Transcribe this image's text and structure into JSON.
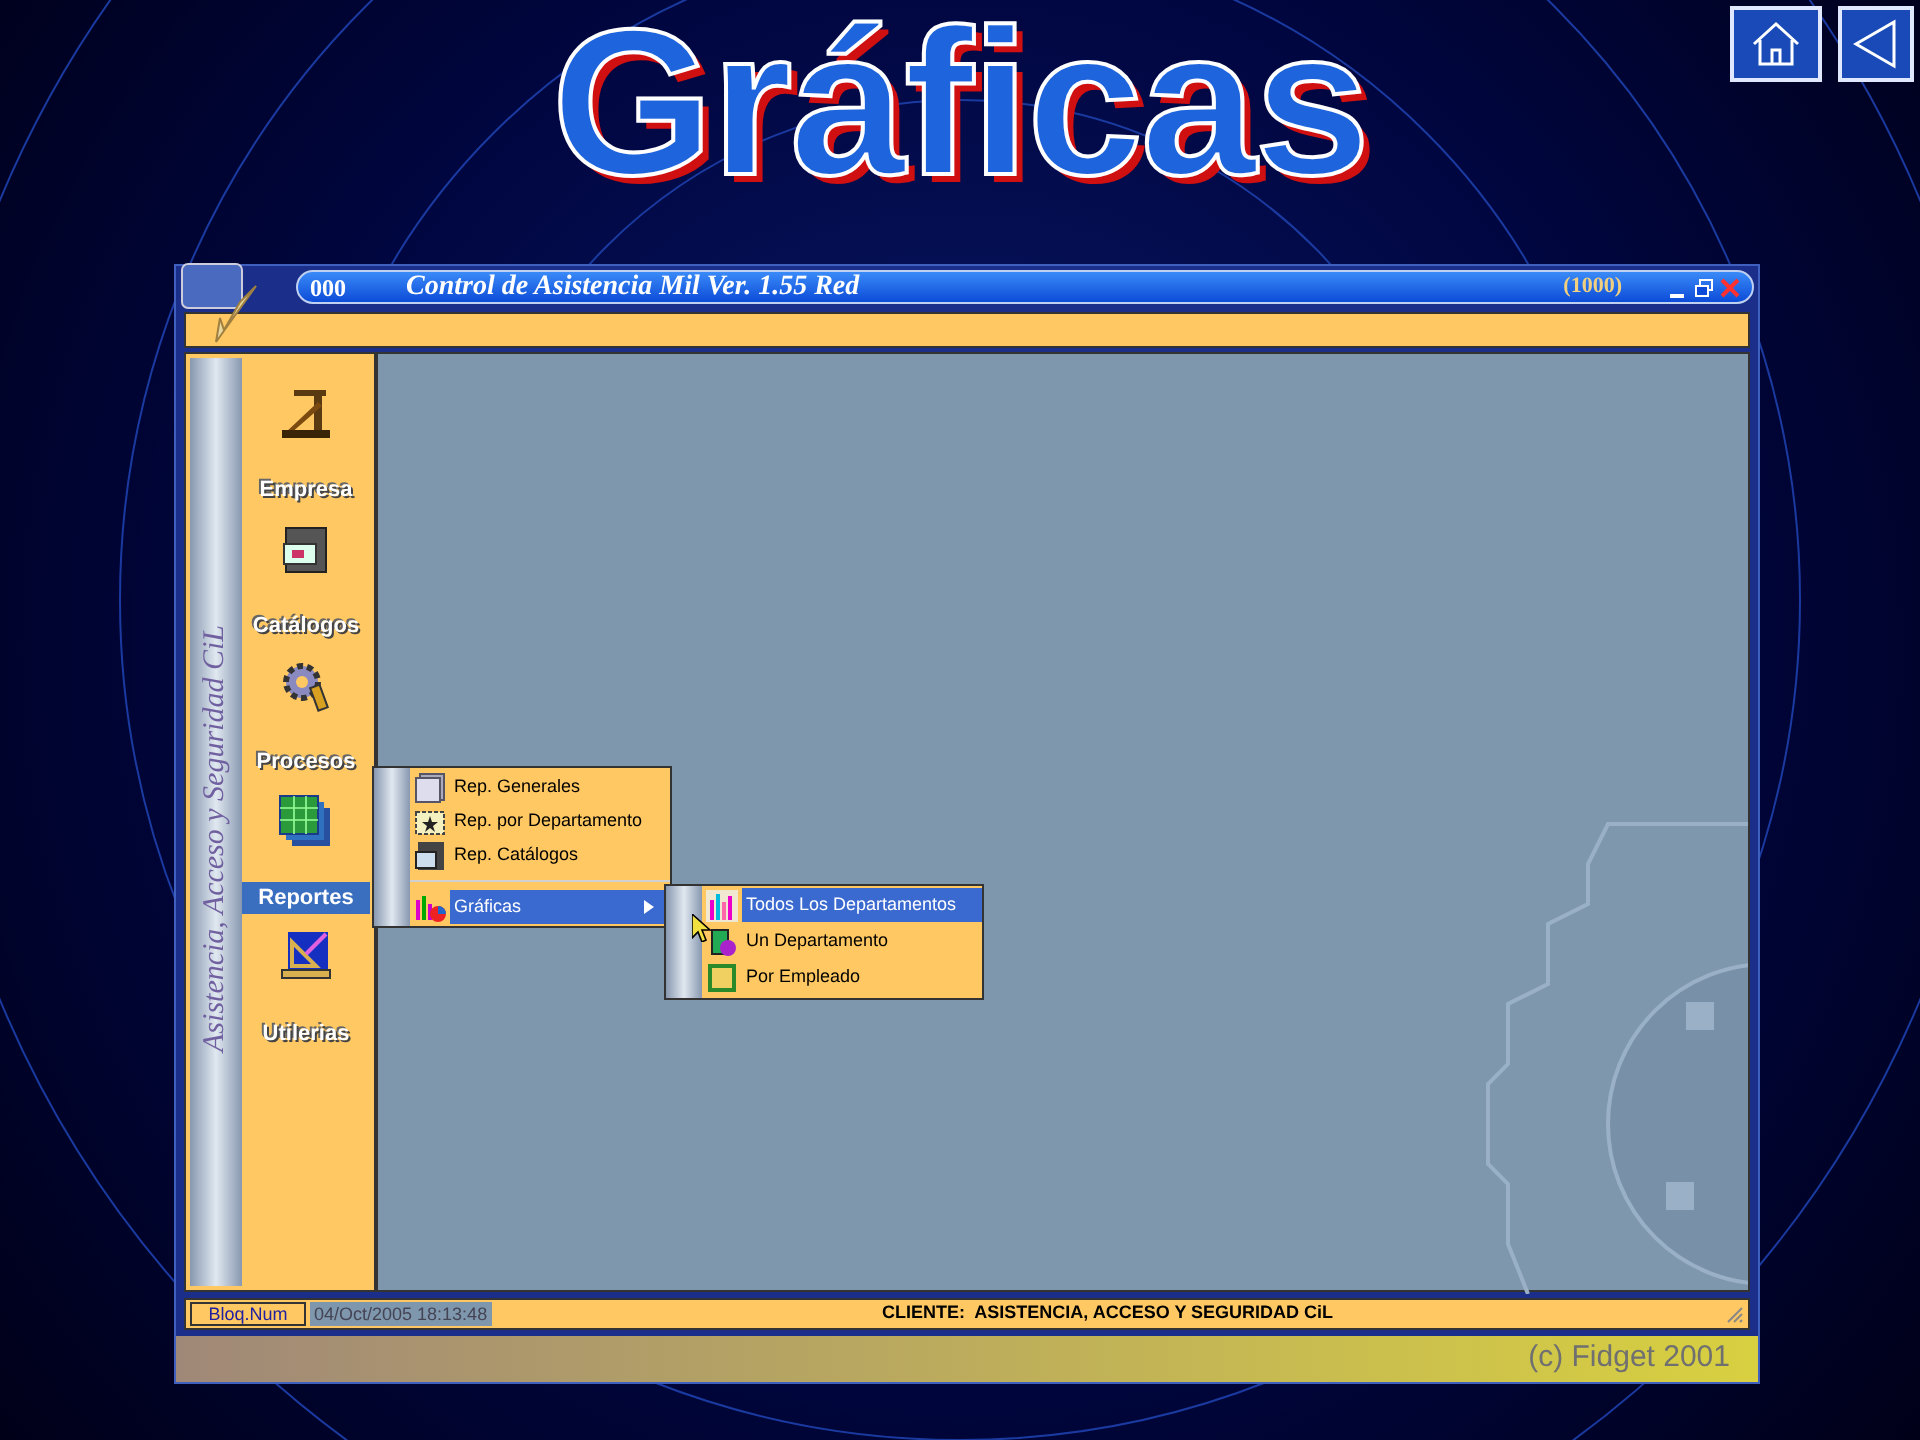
{
  "slide": {
    "title": "Gráficas",
    "copyright": "(c) Fidget 2001"
  },
  "window": {
    "badge": "000",
    "title": "Control de Asistencia Mil Ver. 1.55 Red",
    "code": "(1000)"
  },
  "sidebar": {
    "caption": "Asistencia, Acceso y Seguridad CiL",
    "items": [
      {
        "label": "Empresa",
        "selected": false
      },
      {
        "label": "Catálogos",
        "selected": false
      },
      {
        "label": "Procesos",
        "selected": false
      },
      {
        "label": "Reportes",
        "selected": true
      },
      {
        "label": "Utilerias",
        "selected": false
      }
    ]
  },
  "menu": {
    "items": [
      {
        "label": "Rep. Generales",
        "selected": false,
        "submenu": false
      },
      {
        "label": "Rep. por Departamento",
        "selected": false,
        "submenu": false
      },
      {
        "label": "Rep. Catálogos",
        "selected": false,
        "submenu": false
      },
      {
        "label": "Gráficas",
        "selected": true,
        "submenu": true
      }
    ]
  },
  "submenu": {
    "items": [
      {
        "label": "Todos Los Departamentos",
        "selected": true
      },
      {
        "label": "Un Departamento",
        "selected": false
      },
      {
        "label": "Por Empleado",
        "selected": false
      }
    ]
  },
  "status_bar": {
    "keys": "Bloq.Num",
    "datetime": "04/Oct/2005 18:13:48",
    "client": "CLIENTE:  ASISTENCIA, ACCESO Y SEGURIDAD CiL"
  }
}
